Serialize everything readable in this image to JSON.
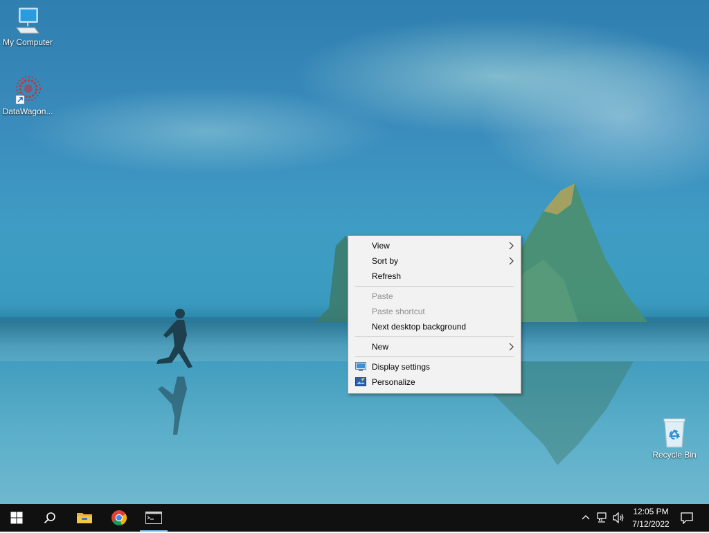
{
  "desktop": {
    "icons": [
      {
        "label": "My Computer",
        "icon": "computer-icon"
      },
      {
        "label": "DataWagon...",
        "icon": "datawagon-shortcut-icon"
      },
      {
        "label": "Recycle Bin",
        "icon": "recycle-bin-icon"
      }
    ]
  },
  "context_menu": {
    "items": [
      {
        "label": "View",
        "submenu": true,
        "enabled": true
      },
      {
        "label": "Sort by",
        "submenu": true,
        "enabled": true
      },
      {
        "label": "Refresh",
        "submenu": false,
        "enabled": true
      },
      {
        "label": "Paste",
        "submenu": false,
        "enabled": false
      },
      {
        "label": "Paste shortcut",
        "submenu": false,
        "enabled": false
      },
      {
        "label": "Next desktop background",
        "submenu": false,
        "enabled": true
      },
      {
        "label": "New",
        "submenu": true,
        "enabled": true
      },
      {
        "label": "Display settings",
        "submenu": false,
        "enabled": true,
        "icon": "display-settings-icon"
      },
      {
        "label": "Personalize",
        "submenu": false,
        "enabled": true,
        "icon": "personalize-icon"
      }
    ]
  },
  "taskbar": {
    "apps": [
      "start-icon",
      "search-icon",
      "file-explorer-icon",
      "chrome-icon",
      "terminal-icon"
    ],
    "tray_icons": [
      "chevron-up-icon",
      "network-icon",
      "volume-icon"
    ],
    "time": "12:05 PM",
    "date": "7/12/2022",
    "notification_icon": "notification-icon"
  },
  "colors": {
    "taskbar_bg": "#101010",
    "menu_bg": "#f2f2f2",
    "menu_disabled_text": "#8f8f8f",
    "accent": "#76b9ed"
  }
}
